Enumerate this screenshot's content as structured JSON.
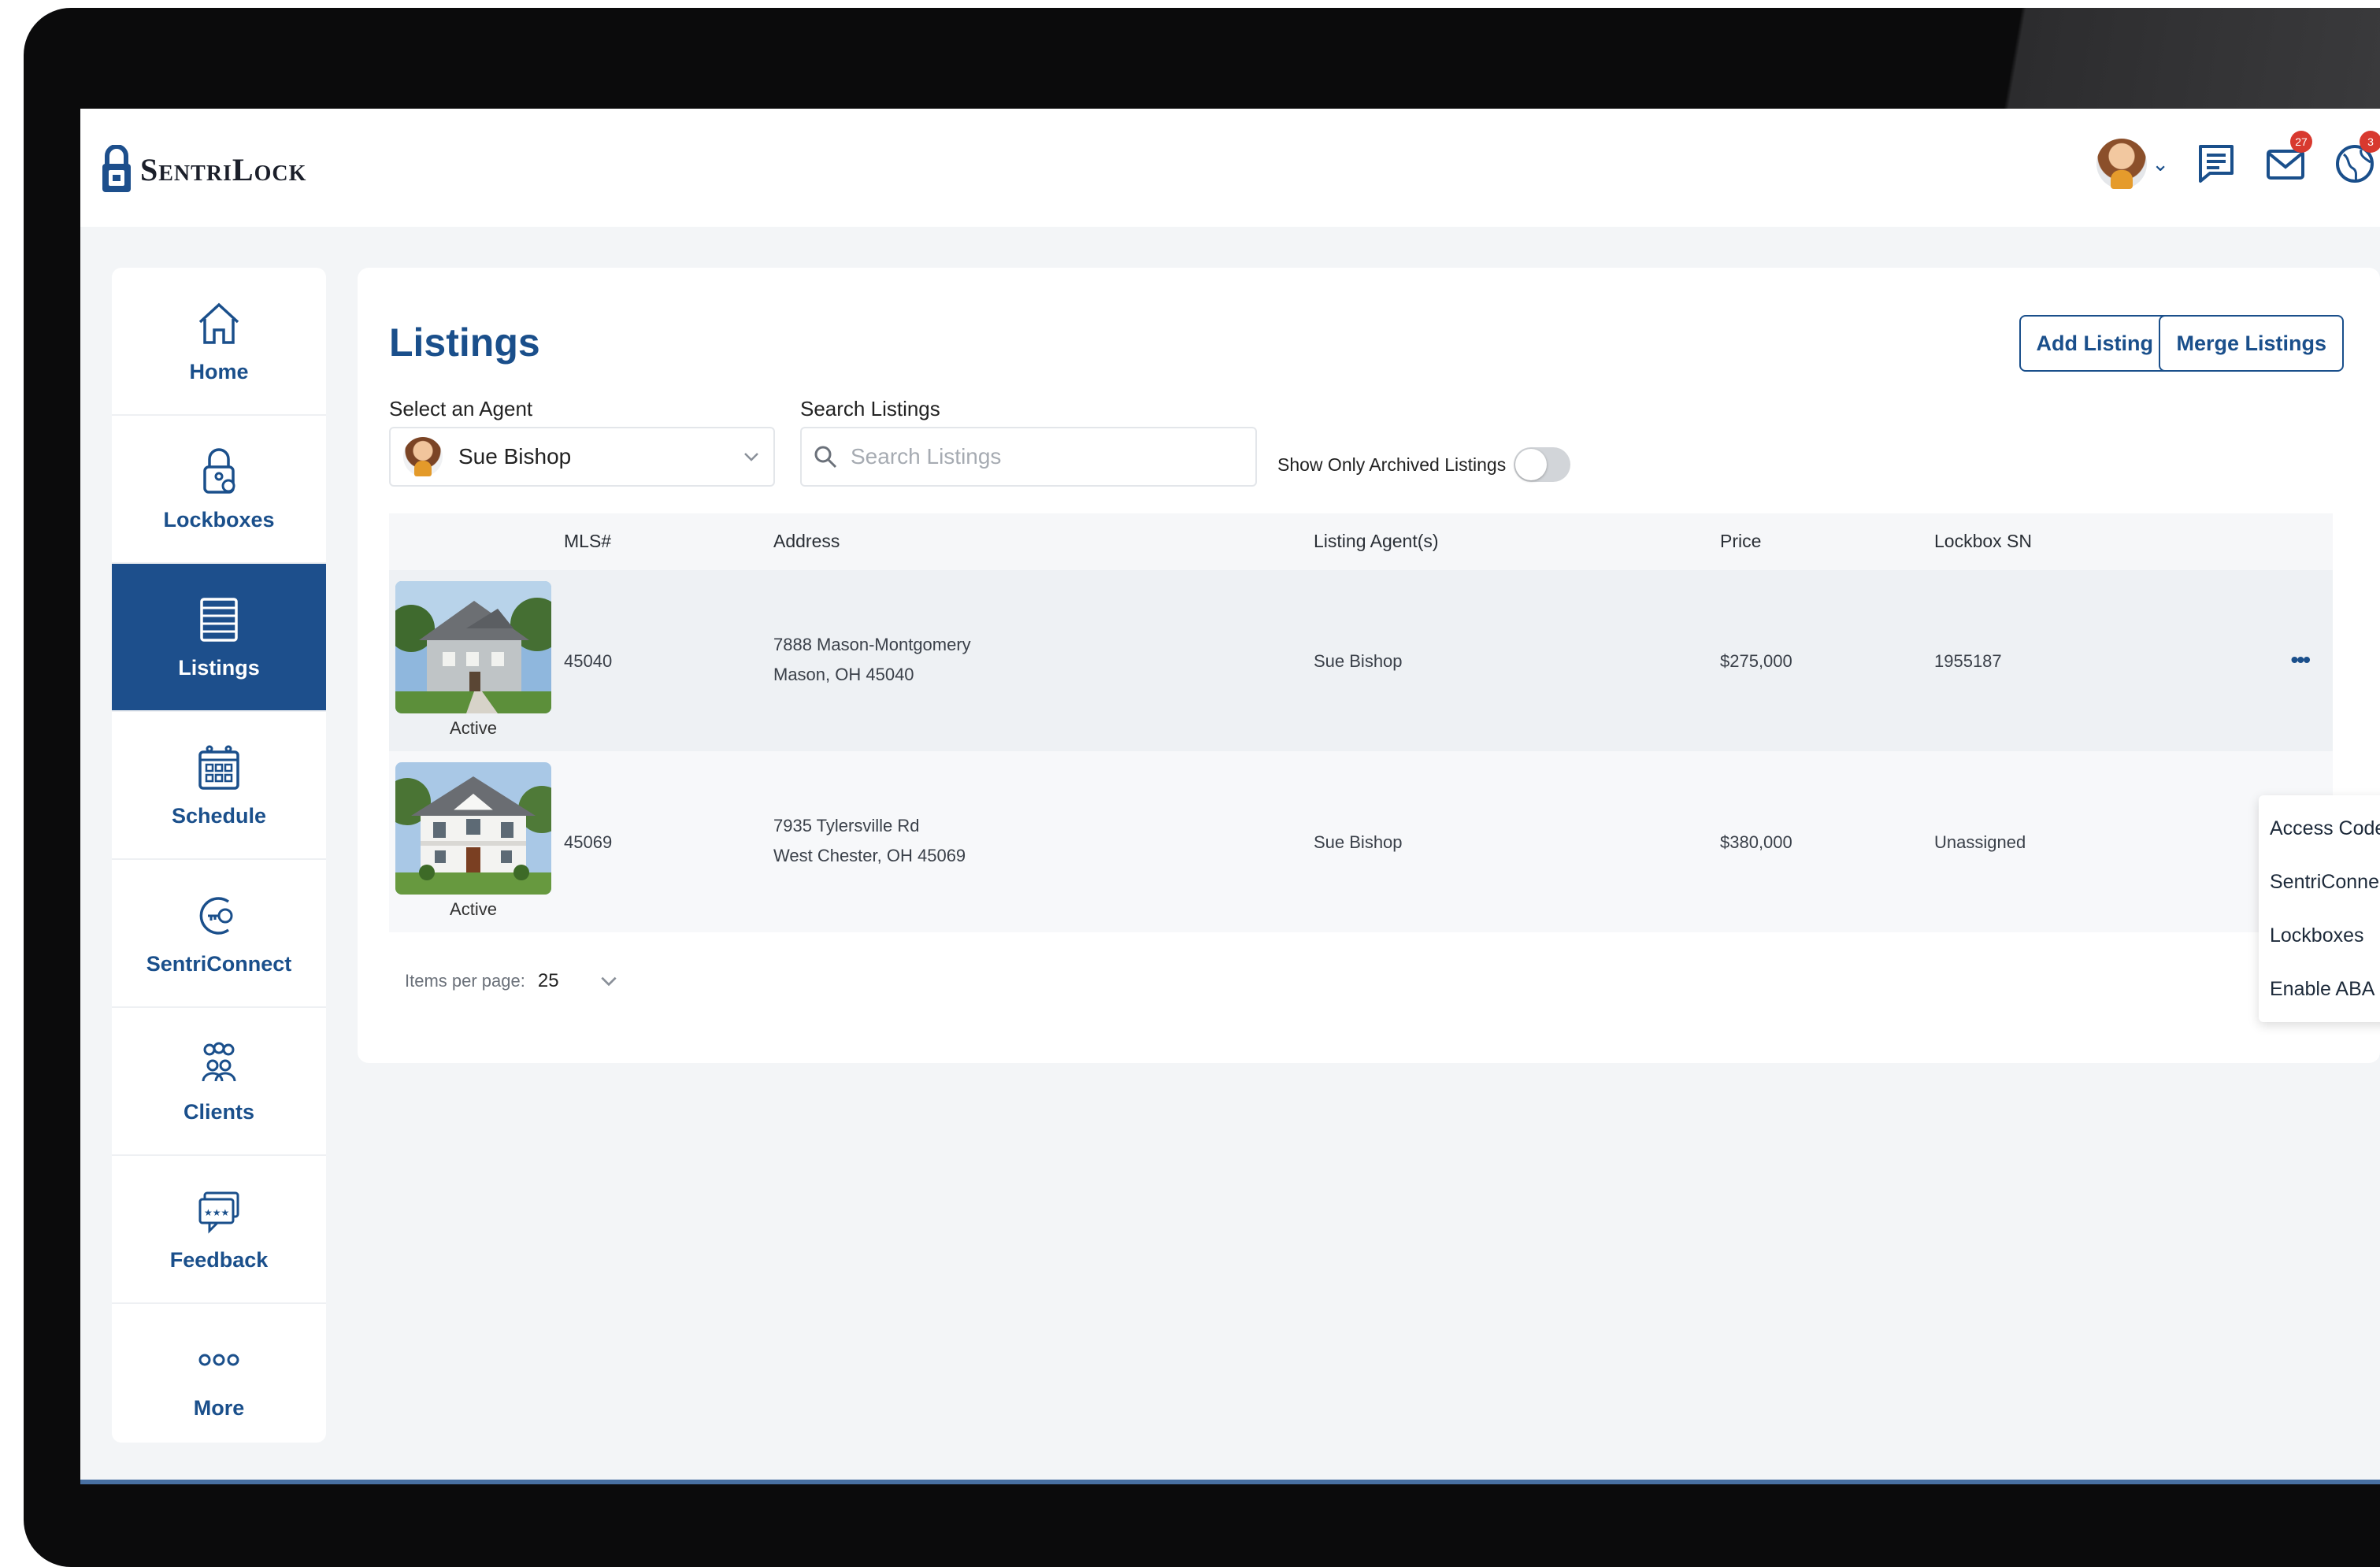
{
  "app": {
    "brand": "SentriLock",
    "notifications": {
      "mail_count": "27",
      "world_count": "3"
    }
  },
  "sidebar": {
    "items": [
      {
        "label": "Home",
        "icon": "home-icon"
      },
      {
        "label": "Lockboxes",
        "icon": "lockbox-icon"
      },
      {
        "label": "Listings",
        "icon": "listings-icon",
        "active": true
      },
      {
        "label": "Schedule",
        "icon": "calendar-icon"
      },
      {
        "label": "SentriConnect",
        "icon": "sentriconnect-icon"
      },
      {
        "label": "Clients",
        "icon": "clients-icon"
      },
      {
        "label": "Feedback",
        "icon": "feedback-icon"
      },
      {
        "label": "More",
        "icon": "more-icon"
      }
    ]
  },
  "main": {
    "title": "Listings",
    "add_listing_label": "Add Listing",
    "merge_listings_label": "Merge Listings",
    "agent_select": {
      "label": "Select an Agent",
      "value": "Sue Bishop"
    },
    "search": {
      "label": "Search Listings",
      "placeholder": "Search Listings",
      "value": ""
    },
    "archived_toggle": {
      "label": "Show Only Archived Listings",
      "on": false
    },
    "table": {
      "columns": [
        "MLS#",
        "Address",
        "Listing Agent(s)",
        "Price",
        "Lockbox SN"
      ],
      "rows": [
        {
          "status": "Active",
          "mls": "45040",
          "address_line1": "7888 Mason-Montgomery",
          "address_line2": "Mason, OH 45040",
          "agent": "Sue Bishop",
          "price": "$275,000",
          "lockbox_sn": "1955187"
        },
        {
          "status": "Active",
          "mls": "45069",
          "address_line1": "7935 Tylersville Rd",
          "address_line2": "West Chester, OH 45069",
          "agent": "Sue Bishop",
          "price": "$380,000",
          "lockbox_sn": "Unassigned"
        }
      ]
    },
    "row_menu": [
      "Access Codes",
      "SentriConnect",
      "Lockboxes",
      "Enable ABA"
    ],
    "pagination": {
      "items_per_page_label": "Items per page:",
      "items_per_page": "25"
    }
  },
  "colors": {
    "brand_blue": "#1d4f8c",
    "badge_red": "#d8392f"
  }
}
